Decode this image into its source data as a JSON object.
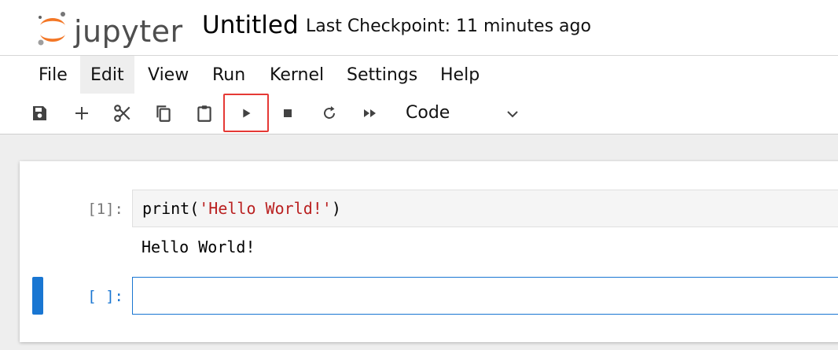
{
  "header": {
    "logo_text": "jupyter",
    "notebook_title": "Untitled",
    "checkpoint": "Last Checkpoint: 11 minutes ago"
  },
  "menu": {
    "items": [
      "File",
      "Edit",
      "View",
      "Run",
      "Kernel",
      "Settings",
      "Help"
    ],
    "active": "Edit"
  },
  "toolbar": {
    "buttons": [
      "save-icon",
      "add-cell-icon",
      "cut-icon",
      "copy-icon",
      "paste-icon",
      "run-icon",
      "stop-icon",
      "restart-icon",
      "run-all-icon"
    ],
    "highlighted": "run-icon",
    "cell_type": "Code"
  },
  "cells": [
    {
      "prompt": "[1]:",
      "code_func": "print(",
      "code_string": "'Hello World!'",
      "code_close": ")",
      "output": "Hello World!"
    },
    {
      "prompt": "[ ]:",
      "code": ""
    }
  ],
  "colors": {
    "accent": "#1976d2",
    "highlight": "#e53935",
    "string": "#ba2121",
    "logo_orange": "#f37726"
  }
}
